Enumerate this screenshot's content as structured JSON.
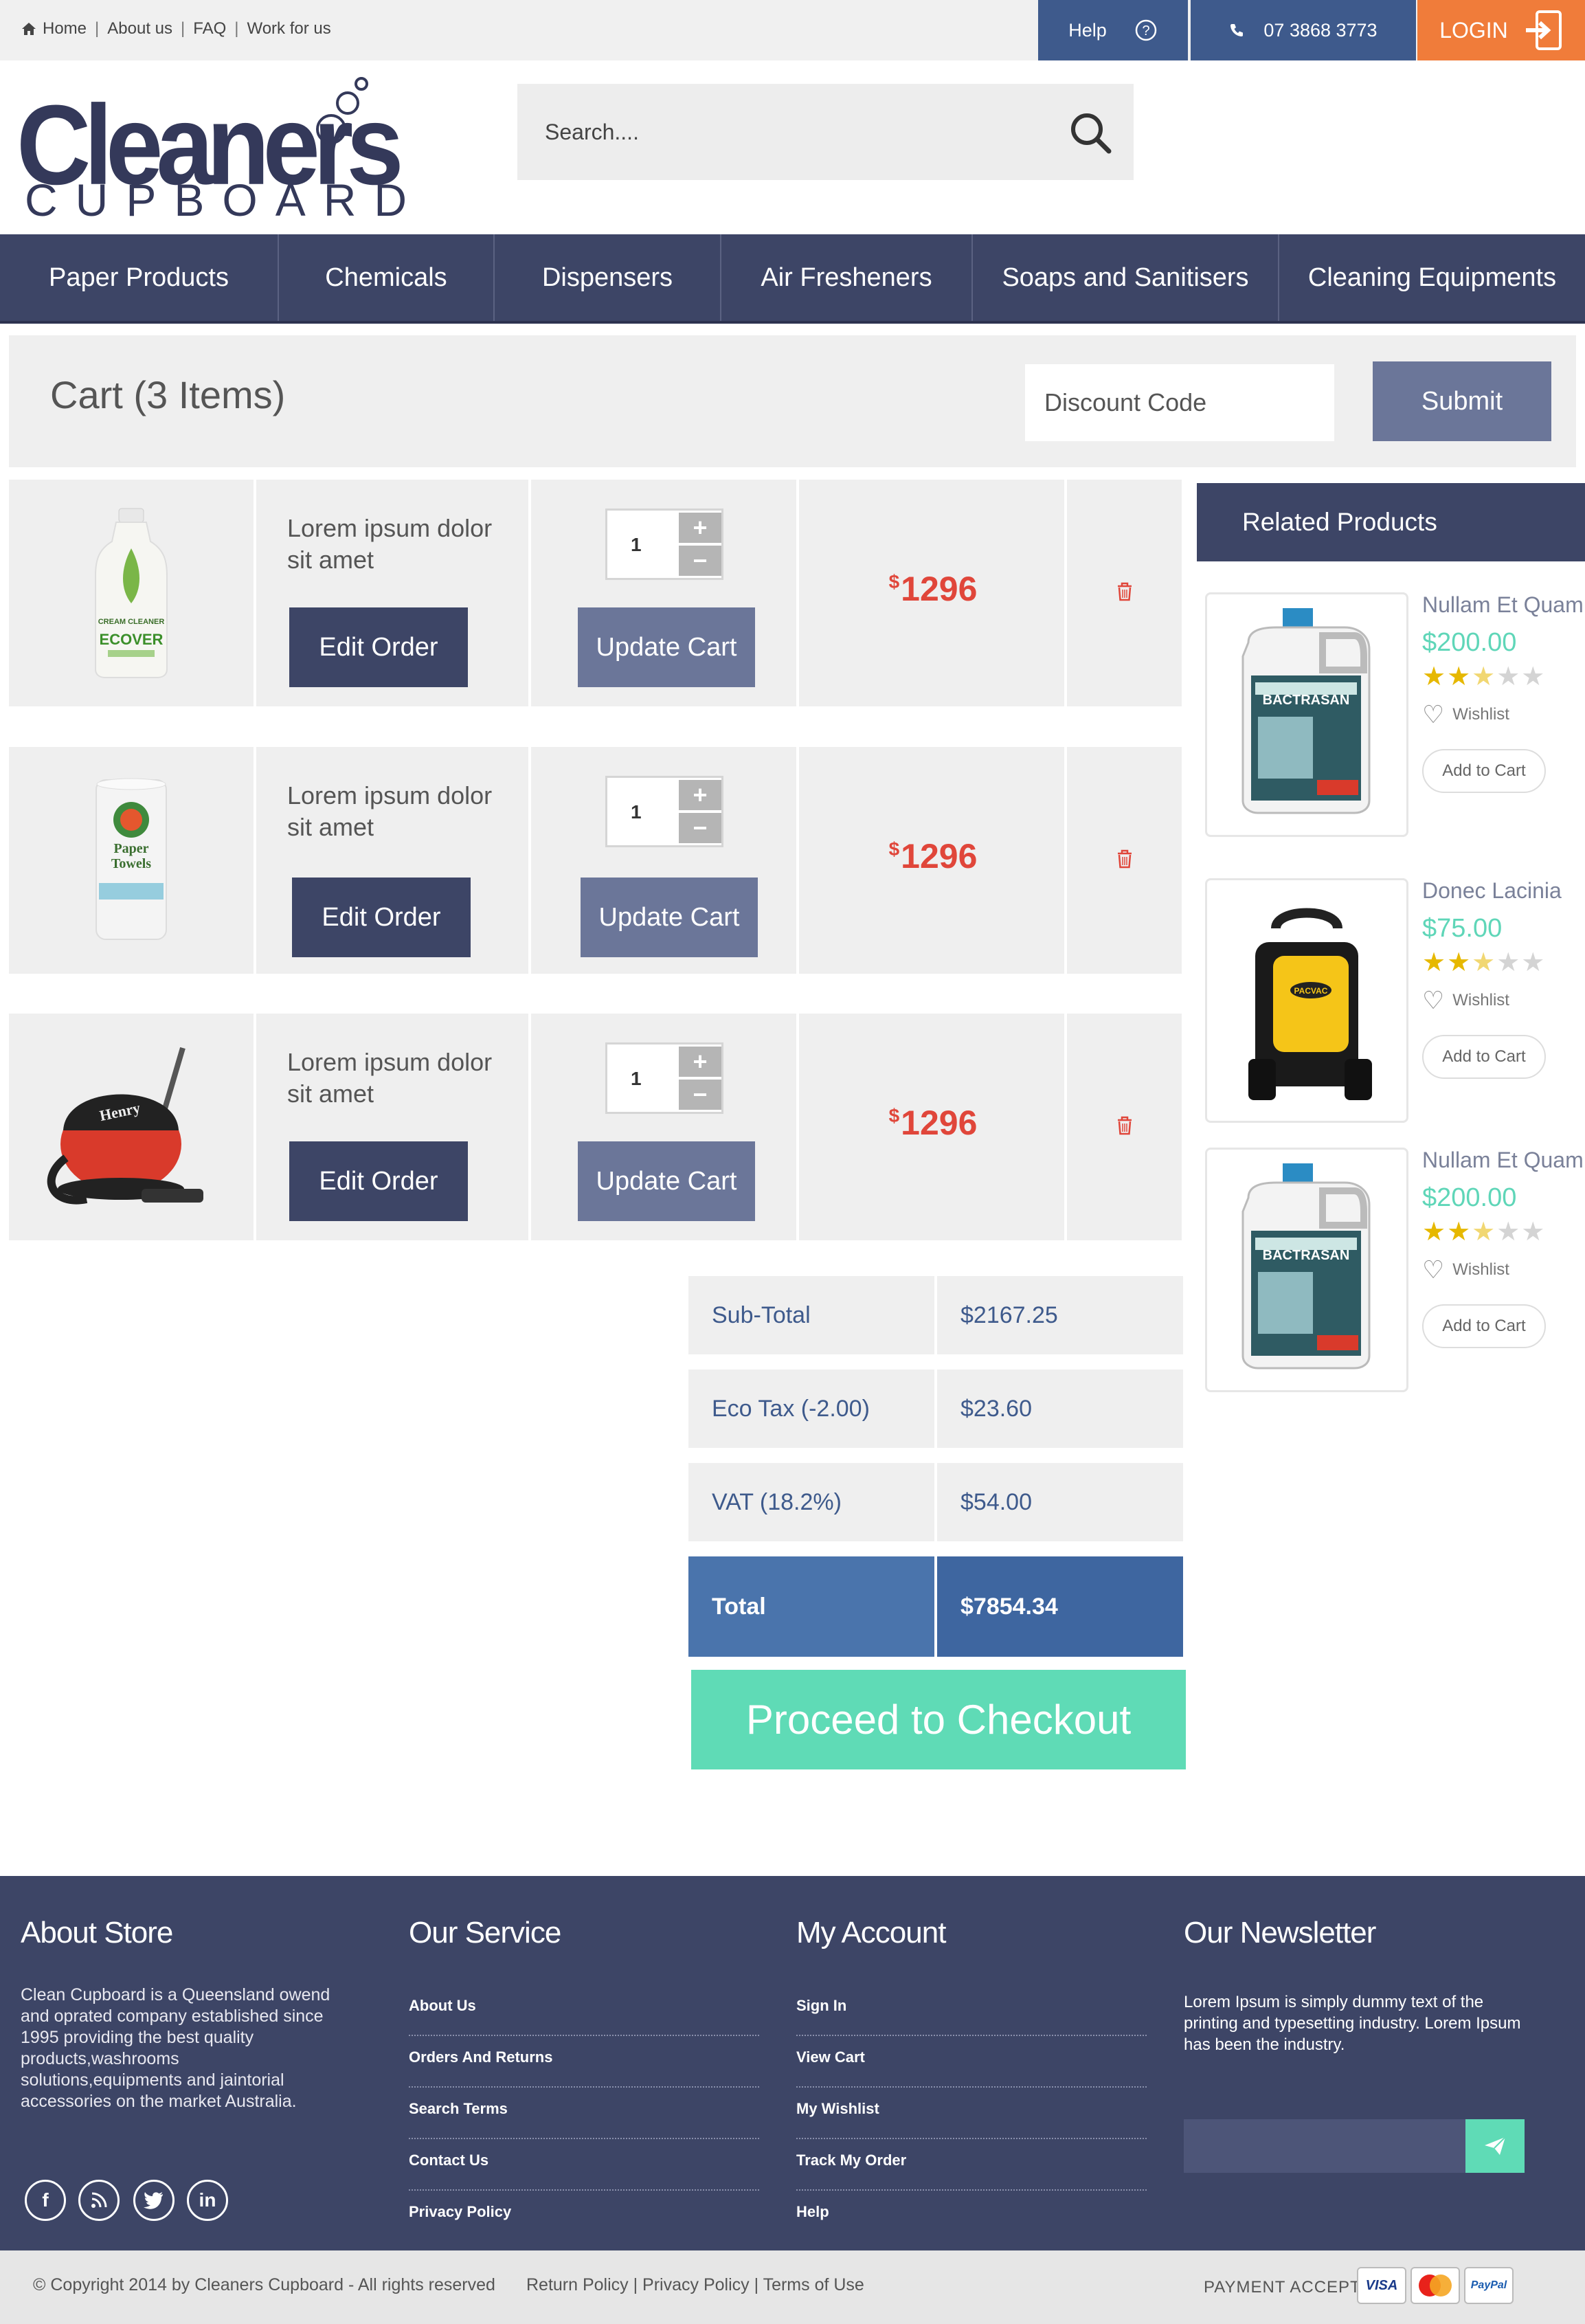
{
  "topbar": {
    "links": [
      "Home",
      "About us",
      "FAQ",
      "Work for us"
    ],
    "help_label": "Help",
    "phone": "07 3868 3773",
    "login_label": "LOGIN"
  },
  "logo": {
    "brand": "Cleaners",
    "sub": "CUPBOARD"
  },
  "search": {
    "placeholder": "Search...."
  },
  "nav": {
    "items": [
      "Paper Products",
      "Chemicals",
      "Dispensers",
      "Air Fresheners",
      "Soaps and Sanitisers",
      "Cleaning Equipments"
    ]
  },
  "cart": {
    "title": "Cart (3 Items)",
    "discount_placeholder": "Discount Code",
    "submit_label": "Submit",
    "items": [
      {
        "name": "Lorem ipsum dolor sit amet",
        "qty": "1",
        "currency": "$",
        "price": "1296",
        "edit_label": "Edit Order",
        "update_label": "Update Cart",
        "image": "ecover-bottle"
      },
      {
        "name": "Lorem ipsum dolor sit amet",
        "qty": "1",
        "currency": "$",
        "price": "1296",
        "edit_label": "Edit Order",
        "update_label": "Update Cart",
        "image": "paper-towels"
      },
      {
        "name": "Lorem ipsum dolor sit amet",
        "qty": "1",
        "currency": "$",
        "price": "1296",
        "edit_label": "Edit Order",
        "update_label": "Update Cart",
        "image": "henry-vacuum"
      }
    ]
  },
  "totals": {
    "rows": [
      {
        "label": "Sub-Total",
        "value": "$2167.25"
      },
      {
        "label": "Eco Tax (-2.00)",
        "value": "$23.60"
      },
      {
        "label": "VAT (18.2%)",
        "value": "$54.00"
      }
    ],
    "total_label": "Total",
    "total_value": "$7854.34",
    "checkout_label": "Proceed to Checkout"
  },
  "related": {
    "title": "Related Products",
    "items": [
      {
        "name": "Nullam Et Quam",
        "price": "$200.00",
        "rating": 2.5,
        "wishlist_label": "Wishlist",
        "cart_label": "Add to Cart",
        "image": "bactrasan-jug"
      },
      {
        "name": "Donec Lacinia",
        "price": "$75.00",
        "rating": 2.5,
        "wishlist_label": "Wishlist",
        "cart_label": "Add to Cart",
        "image": "backpack-vacuum"
      },
      {
        "name": "Nullam Et Quam",
        "price": "$200.00",
        "rating": 2.5,
        "wishlist_label": "Wishlist",
        "cart_label": "Add to Cart",
        "image": "bactrasan-jug"
      }
    ]
  },
  "footer": {
    "about_title": "About Store",
    "about_text": "Clean Cupboard is a Queensland owend and oprated  company established since 1995 providing the best quality products,washrooms solutions,equipments and jaintorial accessories on the market Australia.",
    "service_title": "Our Service",
    "service_links": [
      "About Us",
      "Orders And Returns",
      "Search Terms",
      "Contact Us",
      "Privacy Policy"
    ],
    "account_title": "My Account",
    "account_links": [
      "Sign In",
      "View Cart",
      "My Wishlist",
      "Track My Order",
      "Help"
    ],
    "newsletter_title": "Our Newsletter",
    "newsletter_text": "Lorem Ipsum is simply dummy text of the printing and typesetting industry. Lorem Ipsum has been the industry.",
    "social": [
      "facebook-icon",
      "rss-icon",
      "twitter-icon",
      "linkedin-icon"
    ]
  },
  "bottombar": {
    "copyright": "© Copyright 2014 by Cleaners Cupboard - All rights reserved",
    "policies": "Return Policy | Privacy Policy | Terms of Use",
    "payment_label": "PAYMENT ACCEPT",
    "cards": [
      "VISA",
      "MasterCard",
      "PayPal"
    ]
  },
  "colors": {
    "navy": "#3d4566",
    "blue": "#3e5a8c",
    "orange": "#f07c3a",
    "price_red": "#e0463a",
    "teal": "#5fdbb6"
  }
}
